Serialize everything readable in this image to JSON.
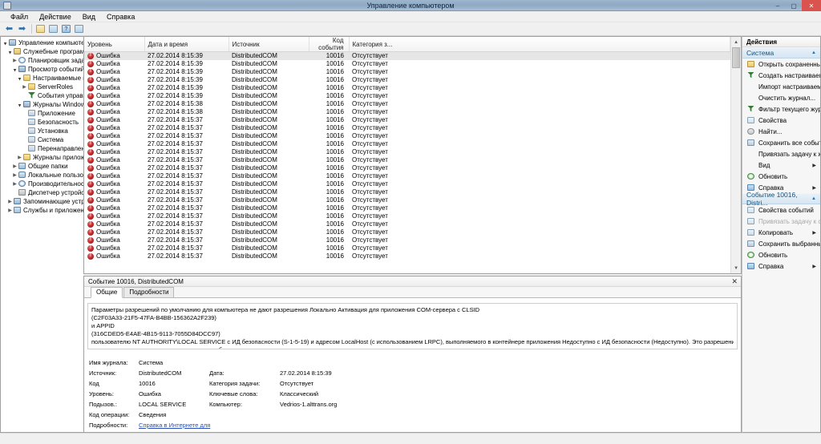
{
  "window": {
    "title": "Управление компьютером",
    "minimize": "–",
    "maximize": "▢",
    "close": "✕"
  },
  "menu": [
    {
      "label": "Файл"
    },
    {
      "label": "Действие"
    },
    {
      "label": "Вид"
    },
    {
      "label": "Справка"
    }
  ],
  "toolbar": {
    "back": "⬅",
    "forward": "➡",
    "buttons": [
      "up-folder",
      "show-pane",
      "help",
      "show-action-pane"
    ]
  },
  "tree": [
    {
      "label": "Управление компьютером (V",
      "depth": 0,
      "twisty": "expanded",
      "icon": "ic-comp"
    },
    {
      "label": "Служебные программы",
      "depth": 1,
      "twisty": "expanded",
      "icon": "ic-tools"
    },
    {
      "label": "Планировщик заданий",
      "depth": 2,
      "twisty": "collapsed",
      "icon": "ic-clock"
    },
    {
      "label": "Просмотр событий",
      "depth": 2,
      "twisty": "expanded",
      "icon": "ic-evt"
    },
    {
      "label": "Настраиваемые пр",
      "depth": 3,
      "twisty": "expanded",
      "icon": "ic-fold"
    },
    {
      "label": "ServerRoles",
      "depth": 4,
      "twisty": "collapsed",
      "icon": "ic-fold"
    },
    {
      "label": "События управ.",
      "depth": 4,
      "twisty": "none",
      "icon": "ic-funnel"
    },
    {
      "label": "Журналы Windows",
      "depth": 3,
      "twisty": "expanded",
      "icon": "ic-evt"
    },
    {
      "label": "Приложение",
      "depth": 4,
      "twisty": "none",
      "icon": "ic-log"
    },
    {
      "label": "Безопасность",
      "depth": 4,
      "twisty": "none",
      "icon": "ic-log"
    },
    {
      "label": "Установка",
      "depth": 4,
      "twisty": "none",
      "icon": "ic-log"
    },
    {
      "label": "Система",
      "depth": 4,
      "twisty": "none",
      "icon": "ic-log"
    },
    {
      "label": "Перенаправлен",
      "depth": 4,
      "twisty": "none",
      "icon": "ic-log"
    },
    {
      "label": "Журналы приложе",
      "depth": 3,
      "twisty": "collapsed",
      "icon": "ic-fold"
    },
    {
      "label": "Общие папки",
      "depth": 2,
      "twisty": "collapsed",
      "icon": "ic-shared"
    },
    {
      "label": "Локальные пользоват",
      "depth": 2,
      "twisty": "collapsed",
      "icon": "ic-users"
    },
    {
      "label": "Производительность",
      "depth": 2,
      "twisty": "collapsed",
      "icon": "ic-perf"
    },
    {
      "label": "Диспетчер устройств",
      "depth": 2,
      "twisty": "none",
      "icon": "ic-dev"
    },
    {
      "label": "Запоминающие устройст",
      "depth": 1,
      "twisty": "collapsed",
      "icon": "ic-stor"
    },
    {
      "label": "Службы и приложения",
      "depth": 1,
      "twisty": "collapsed",
      "icon": "ic-svc"
    }
  ],
  "list": {
    "columns": [
      "Уровень",
      "Дата и время",
      "Источник",
      "Код события",
      "Категория з..."
    ],
    "rows": [
      {
        "level": "Ошибка",
        "datetime": "27.02.2014 8:15:39",
        "source": "DistributedCOM",
        "event_id": "10016",
        "category": "Отсутствует",
        "selected": true
      },
      {
        "level": "Ошибка",
        "datetime": "27.02.2014 8:15:39",
        "source": "DistributedCOM",
        "event_id": "10016",
        "category": "Отсутствует",
        "selected": false
      },
      {
        "level": "Ошибка",
        "datetime": "27.02.2014 8:15:39",
        "source": "DistributedCOM",
        "event_id": "10016",
        "category": "Отсутствует",
        "selected": false
      },
      {
        "level": "Ошибка",
        "datetime": "27.02.2014 8:15:39",
        "source": "DistributedCOM",
        "event_id": "10016",
        "category": "Отсутствует",
        "selected": false
      },
      {
        "level": "Ошибка",
        "datetime": "27.02.2014 8:15:39",
        "source": "DistributedCOM",
        "event_id": "10016",
        "category": "Отсутствует",
        "selected": false
      },
      {
        "level": "Ошибка",
        "datetime": "27.02.2014 8:15:39",
        "source": "DistributedCOM",
        "event_id": "10016",
        "category": "Отсутствует",
        "selected": false
      },
      {
        "level": "Ошибка",
        "datetime": "27.02.2014 8:15:38",
        "source": "DistributedCOM",
        "event_id": "10016",
        "category": "Отсутствует",
        "selected": false
      },
      {
        "level": "Ошибка",
        "datetime": "27.02.2014 8:15:38",
        "source": "DistributedCOM",
        "event_id": "10016",
        "category": "Отсутствует",
        "selected": false
      },
      {
        "level": "Ошибка",
        "datetime": "27.02.2014 8:15:37",
        "source": "DistributedCOM",
        "event_id": "10016",
        "category": "Отсутствует",
        "selected": false
      },
      {
        "level": "Ошибка",
        "datetime": "27.02.2014 8:15:37",
        "source": "DistributedCOM",
        "event_id": "10016",
        "category": "Отсутствует",
        "selected": false
      },
      {
        "level": "Ошибка",
        "datetime": "27.02.2014 8:15:37",
        "source": "DistributedCOM",
        "event_id": "10016",
        "category": "Отсутствует",
        "selected": false
      },
      {
        "level": "Ошибка",
        "datetime": "27.02.2014 8:15:37",
        "source": "DistributedCOM",
        "event_id": "10016",
        "category": "Отсутствует",
        "selected": false
      },
      {
        "level": "Ошибка",
        "datetime": "27.02.2014 8:15:37",
        "source": "DistributedCOM",
        "event_id": "10016",
        "category": "Отсутствует",
        "selected": false
      },
      {
        "level": "Ошибка",
        "datetime": "27.02.2014 8:15:37",
        "source": "DistributedCOM",
        "event_id": "10016",
        "category": "Отсутствует",
        "selected": false
      },
      {
        "level": "Ошибка",
        "datetime": "27.02.2014 8:15:37",
        "source": "DistributedCOM",
        "event_id": "10016",
        "category": "Отсутствует",
        "selected": false
      },
      {
        "level": "Ошибка",
        "datetime": "27.02.2014 8:15:37",
        "source": "DistributedCOM",
        "event_id": "10016",
        "category": "Отсутствует",
        "selected": false
      },
      {
        "level": "Ошибка",
        "datetime": "27.02.2014 8:15:37",
        "source": "DistributedCOM",
        "event_id": "10016",
        "category": "Отсутствует",
        "selected": false
      },
      {
        "level": "Ошибка",
        "datetime": "27.02.2014 8:15:37",
        "source": "DistributedCOM",
        "event_id": "10016",
        "category": "Отсутствует",
        "selected": false
      },
      {
        "level": "Ошибка",
        "datetime": "27.02.2014 8:15:37",
        "source": "DistributedCOM",
        "event_id": "10016",
        "category": "Отсутствует",
        "selected": false
      },
      {
        "level": "Ошибка",
        "datetime": "27.02.2014 8:15:37",
        "source": "DistributedCOM",
        "event_id": "10016",
        "category": "Отсутствует",
        "selected": false
      },
      {
        "level": "Ошибка",
        "datetime": "27.02.2014 8:15:37",
        "source": "DistributedCOM",
        "event_id": "10016",
        "category": "Отсутствует",
        "selected": false
      },
      {
        "level": "Ошибка",
        "datetime": "27.02.2014 8:15:37",
        "source": "DistributedCOM",
        "event_id": "10016",
        "category": "Отсутствует",
        "selected": false
      },
      {
        "level": "Ошибка",
        "datetime": "27.02.2014 8:15:37",
        "source": "DistributedCOM",
        "event_id": "10016",
        "category": "Отсутствует",
        "selected": false
      },
      {
        "level": "Ошибка",
        "datetime": "27.02.2014 8:15:37",
        "source": "DistributedCOM",
        "event_id": "10016",
        "category": "Отсутствует",
        "selected": false
      },
      {
        "level": "Ошибка",
        "datetime": "27.02.2014 8:15:37",
        "source": "DistributedCOM",
        "event_id": "10016",
        "category": "Отсутствует",
        "selected": false
      },
      {
        "level": "Ошибка",
        "datetime": "27.02.2014 8:15:37",
        "source": "DistributedCOM",
        "event_id": "10016",
        "category": "Отсутствует",
        "selected": false
      }
    ]
  },
  "details": {
    "header": "Событие 10016, DistributedCOM",
    "close": "✕",
    "tabs": [
      {
        "label": "Общие",
        "active": true
      },
      {
        "label": "Подробности",
        "active": false
      }
    ],
    "description_lines": [
      "Параметры разрешений по умолчанию для компьютера не дают разрешения Локально Активация для приложения COM-сервера с CLSID",
      "(C2F03A33-21F5-47FA-B4BB-156362A2F239)",
      " и APPID",
      "(316CDED5-E4AE-4B15-9113-7055D84DCC97)",
      " пользователю NT AUTHORITY\\LOCAL SERVICE с ИД безопасности (S-1-5-19) и адресом LocalHost (с использованием LRPC), выполняемого в контейнере приложения Недоступно с ИД безопасности (Недоступно). Это разрешение безопасности можно изменить с",
      "помощью средства администрирования служб компонентов."
    ],
    "fields": {
      "log_name_label": "Имя журнала:",
      "log_name_value": "Система",
      "source_label": "Источник:",
      "source_value": "DistributedCOM",
      "date_label": "Дата:",
      "date_value": "27.02.2014 8:15:39",
      "code_label": "Код",
      "code_value": "10016",
      "task_cat_label": "Категория задачи:",
      "task_cat_value": "Отсутствует",
      "level_label": "Уровень:",
      "level_value": "Ошибка",
      "keywords_label": "Ключевые слова:",
      "keywords_value": "Классический",
      "user_label": "Подызов.:",
      "user_value": "LOCAL SERVICE",
      "computer_label": "Компьютер:",
      "computer_value": "Vedrios-1.alttrans.org",
      "opcode_label": "Код операции:",
      "opcode_value": "Сведения",
      "more_label": "Подробности:",
      "more_link": "Справка в Интернете для"
    }
  },
  "actions": {
    "title": "Действия",
    "sections": [
      {
        "name": "Система",
        "caret": "▲",
        "items": [
          {
            "label": "Открыть сохраненны...",
            "icon": "ai-open",
            "submenu": false,
            "disabled": false
          },
          {
            "label": "Создать настраиваем...",
            "icon": "ai-filter",
            "submenu": false,
            "disabled": false
          },
          {
            "label": "Импорт настраиваем...",
            "icon": "ai-none",
            "submenu": false,
            "disabled": false
          },
          {
            "label": "Очистить журнал...",
            "icon": "ai-none",
            "submenu": false,
            "disabled": false
          },
          {
            "label": "Фильтр текущего жур...",
            "icon": "ai-filter",
            "submenu": false,
            "disabled": false
          },
          {
            "label": "Свойства",
            "icon": "ai-prop",
            "submenu": false,
            "disabled": false
          },
          {
            "label": "Найти...",
            "icon": "ai-find",
            "submenu": false,
            "disabled": false
          },
          {
            "label": "Сохранить все событи...",
            "icon": "ai-save",
            "submenu": false,
            "disabled": false
          },
          {
            "label": "Привязать задачу к жу...",
            "icon": "ai-none",
            "submenu": false,
            "disabled": false
          },
          {
            "label": "Вид",
            "icon": "ai-none",
            "submenu": true,
            "disabled": false
          },
          {
            "label": "Обновить",
            "icon": "ai-refr",
            "submenu": false,
            "disabled": false
          },
          {
            "label": "Справка",
            "icon": "ai-help",
            "submenu": true,
            "disabled": false
          }
        ]
      },
      {
        "name": "Событие 10016, Distri...",
        "caret": "▲",
        "items": [
          {
            "label": "Свойства событий",
            "icon": "ai-prop",
            "submenu": false,
            "disabled": false
          },
          {
            "label": "Привязать задачу к со...",
            "icon": "ai-prop",
            "submenu": false,
            "disabled": true
          },
          {
            "label": "Копировать",
            "icon": "ai-copy",
            "submenu": true,
            "disabled": false
          },
          {
            "label": "Сохранить выбранны...",
            "icon": "ai-save",
            "submenu": false,
            "disabled": false
          },
          {
            "label": "Обновить",
            "icon": "ai-refr",
            "submenu": false,
            "disabled": false
          },
          {
            "label": "Справка",
            "icon": "ai-help",
            "submenu": true,
            "disabled": false
          }
        ]
      }
    ]
  },
  "scrollbar": {
    "up": "▲",
    "down": "▼"
  }
}
